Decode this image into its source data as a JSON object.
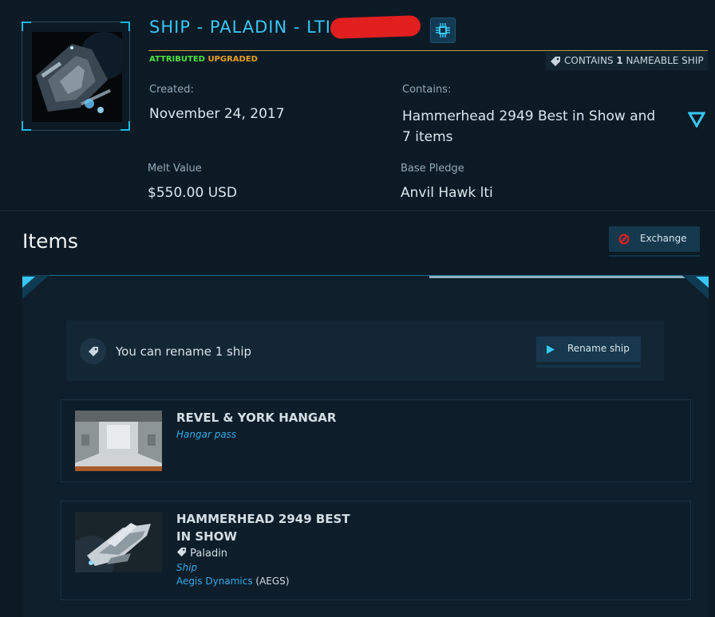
{
  "header": {
    "title": "SHIP - PALADIN - LTI (",
    "status_attributed": "ATTRIBUTED",
    "status_upgraded": "UPGRADED",
    "contains_prefix": "CONTAINS ",
    "contains_count": "1",
    "contains_suffix": " NAMEABLE SHIP"
  },
  "details": {
    "created_label": "Created:",
    "created_value": "November 24, 2017",
    "contains_label": "Contains:",
    "contains_value": "Hammerhead 2949 Best in Show and 7 items",
    "melt_label": "Melt Value",
    "melt_value": "$550.00 USD",
    "base_label": "Base Pledge",
    "base_value": "Anvil Hawk lti"
  },
  "items_section": {
    "heading": "Items",
    "exchange_label": "Exchange"
  },
  "rename": {
    "text": "You can rename 1 ship",
    "button_label": "Rename ship"
  },
  "items": [
    {
      "title": "REVEL & YORK HANGAR",
      "type": "Hangar pass"
    },
    {
      "title": "HAMMERHEAD 2949 BEST IN SHOW",
      "ship_name": "Paladin",
      "type": "Ship",
      "manufacturer": "Aegis Dynamics",
      "manufacturer_code": "AEGS"
    }
  ],
  "colors": {
    "accent": "#39c6f4",
    "attributed": "#4fe13a",
    "upgraded": "#e8a022",
    "link": "#33a9e6",
    "danger": "#e02020"
  }
}
